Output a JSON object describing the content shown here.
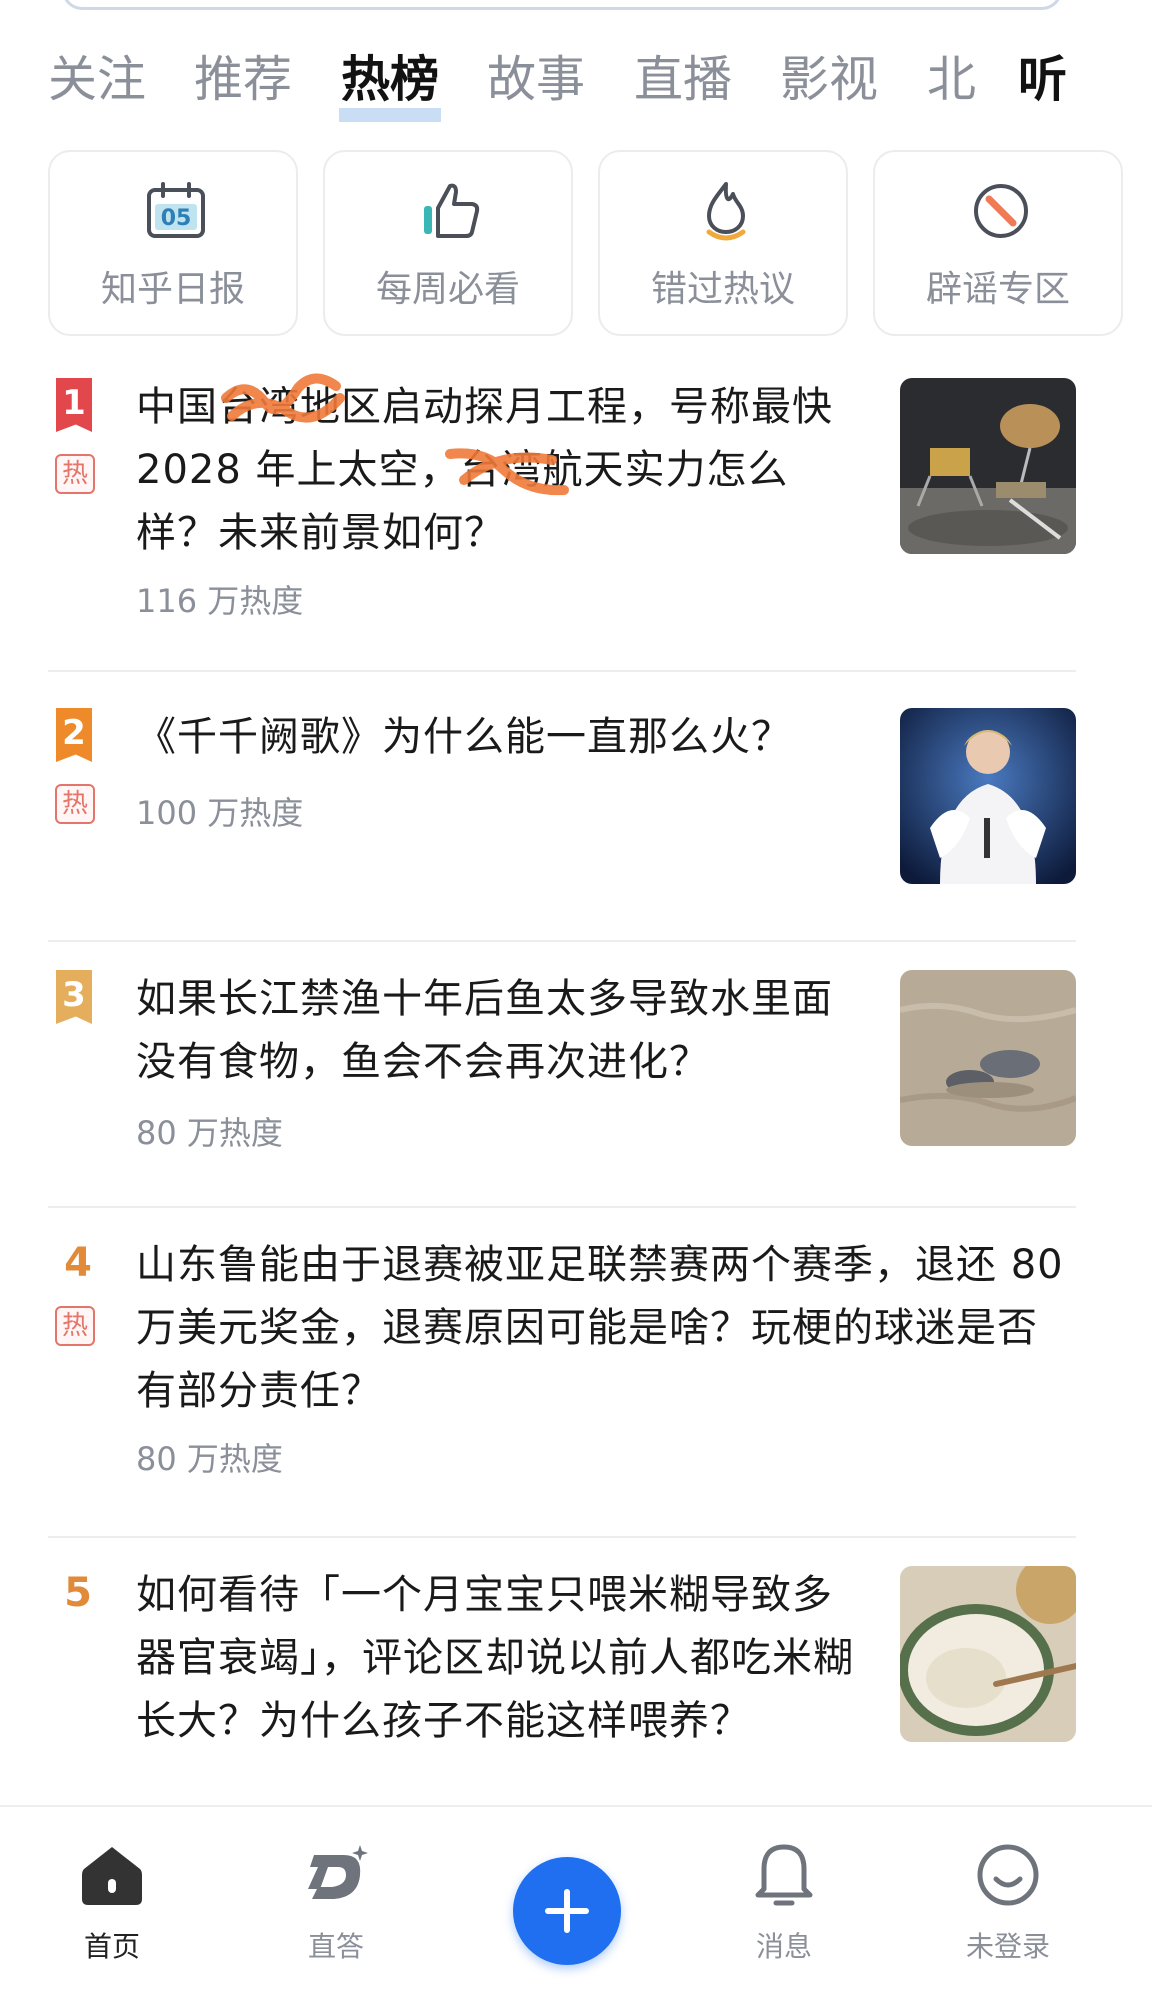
{
  "tabs": [
    "关注",
    "推荐",
    "热榜",
    "故事",
    "直播",
    "影视",
    "北",
    "听"
  ],
  "active_tab": "热榜",
  "quick_cards": [
    {
      "label": "知乎日报",
      "icon": "calendar-icon",
      "date_text": "05"
    },
    {
      "label": "每周必看",
      "icon": "thumbs-up-icon"
    },
    {
      "label": "错过热议",
      "icon": "flame-icon"
    },
    {
      "label": "辟谣专区",
      "icon": "no-entry-icon"
    }
  ],
  "hot_items": [
    {
      "rank": "1",
      "hot_badge": "热",
      "title": "中国台湾地区启动探月工程，号称最快 2028 年上太空，台湾航天实力怎么样？未来前景如何？",
      "heat": "116 万热度",
      "thumb": "lunar-lander-image"
    },
    {
      "rank": "2",
      "hot_badge": "热",
      "title": "《千千阙歌》为什么能一直那么火？",
      "heat": "100 万热度",
      "thumb": "singer-image"
    },
    {
      "rank": "3",
      "hot_badge": "",
      "title": "如果长江禁渔十年后鱼太多导致水里面没有食物，鱼会不会再次进化？",
      "heat": "80 万热度",
      "thumb": "porpoise-image"
    },
    {
      "rank": "4",
      "hot_badge": "热",
      "title": "山东鲁能由于退赛被亚足联禁赛两个赛季，退还 80 万美元奖金，退赛原因可能是啥？玩梗的球迷是否有部分责任？",
      "heat": "80 万热度",
      "thumb": ""
    },
    {
      "rank": "5",
      "hot_badge": "",
      "title": "如何看待「一个月宝宝只喂米糊导致多器官衰竭」，评论区却说以前人都吃米糊长大？为什么孩子不能这样喂养？",
      "heat": "",
      "thumb": "rice-paste-image"
    }
  ],
  "bottom_nav": [
    {
      "label": "首页",
      "icon": "home-icon",
      "active": true
    },
    {
      "label": "直答",
      "icon": "zhida-logo-icon",
      "active": false
    },
    {
      "label": "",
      "icon": "plus-icon",
      "active": false
    },
    {
      "label": "消息",
      "icon": "bell-icon",
      "active": false
    },
    {
      "label": "未登录",
      "icon": "smiley-icon",
      "active": false
    }
  ],
  "colors": {
    "accent_blue": "#1f6ff0",
    "rank1": "#e2474b",
    "rank2": "#ef8a2a",
    "rank3": "#e4ae5c",
    "rank_other": "#e08a3a",
    "hot_badge": "#e4756a",
    "redaction_scribble": "#f07a3a"
  }
}
